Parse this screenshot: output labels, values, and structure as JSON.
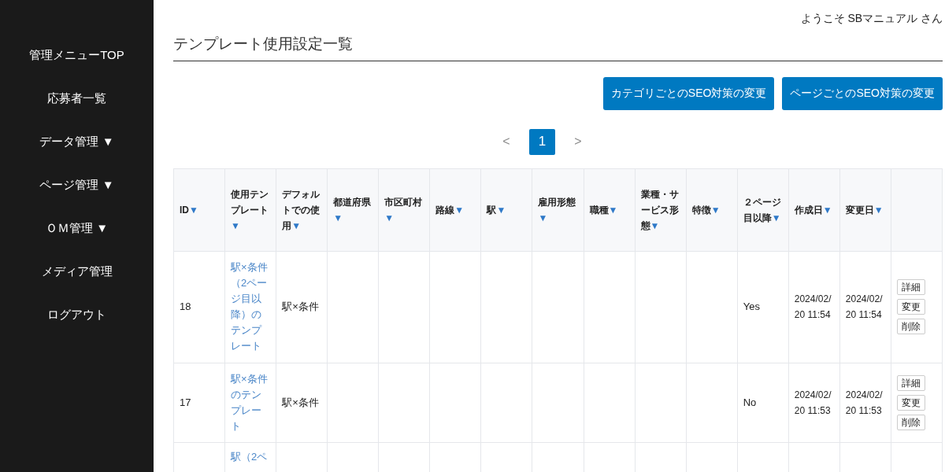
{
  "sidebar": {
    "items": [
      {
        "label": "管理メニューTOP"
      },
      {
        "label": "応募者一覧"
      },
      {
        "label": "データ管理",
        "caret": "▼"
      },
      {
        "label": "ページ管理",
        "caret": "▼"
      },
      {
        "label": "ＯＭ管理",
        "caret": "▼"
      },
      {
        "label": "メディア管理"
      },
      {
        "label": "ログアウト"
      }
    ]
  },
  "header": {
    "welcome": "ようこそ SBマニュアル さん"
  },
  "page_title": "テンプレート使用設定一覧",
  "buttons": [
    "カテゴリごとのSEO対策の変更",
    "ページごとのSEO対策の変更"
  ],
  "pagination": [
    {
      "label": "<",
      "kind": "prev",
      "selected": false
    },
    {
      "label": "1",
      "kind": "page",
      "selected": true
    },
    {
      "label": ">",
      "kind": "next",
      "selected": false
    }
  ],
  "table": {
    "columns": [
      {
        "label": "ID",
        "sort": "▼"
      },
      {
        "label": "使用テンプレート",
        "sort": "▼"
      },
      {
        "label": "デフォルトでの使用",
        "sort": "▼"
      },
      {
        "label": "都道府県",
        "sort": "▼"
      },
      {
        "label": "市区町村",
        "sort": "▼"
      },
      {
        "label": "路線",
        "sort": "▼"
      },
      {
        "label": "駅",
        "sort": "▼"
      },
      {
        "label": "雇用形態",
        "sort": "▼"
      },
      {
        "label": "職種",
        "sort": "▼"
      },
      {
        "label": "業種・サービス形態",
        "sort": "▼"
      },
      {
        "label": "特徴",
        "sort": "▼"
      },
      {
        "label": "２ページ目以降",
        "sort": "▼"
      },
      {
        "label": "作成日",
        "sort": "▼"
      },
      {
        "label": "変更日",
        "sort": "▼"
      },
      {}
    ],
    "rows": [
      {
        "id": "18",
        "template": "駅×条件（2ページ目以降）のテンプレート",
        "default": "駅×条件",
        "second_page": "Yes",
        "created": "2024/02/20 11:54",
        "updated": "2024/02/20 11:54",
        "actions": [
          "詳細",
          "変更",
          "削除"
        ]
      },
      {
        "id": "17",
        "template": "駅×条件のテンプレート",
        "default": "駅×条件",
        "second_page": "No",
        "created": "2024/02/20 11:53",
        "updated": "2024/02/20 11:53",
        "actions": [
          "詳細",
          "変更",
          "削除"
        ]
      },
      {
        "template": "駅（2ペ"
      }
    ]
  }
}
